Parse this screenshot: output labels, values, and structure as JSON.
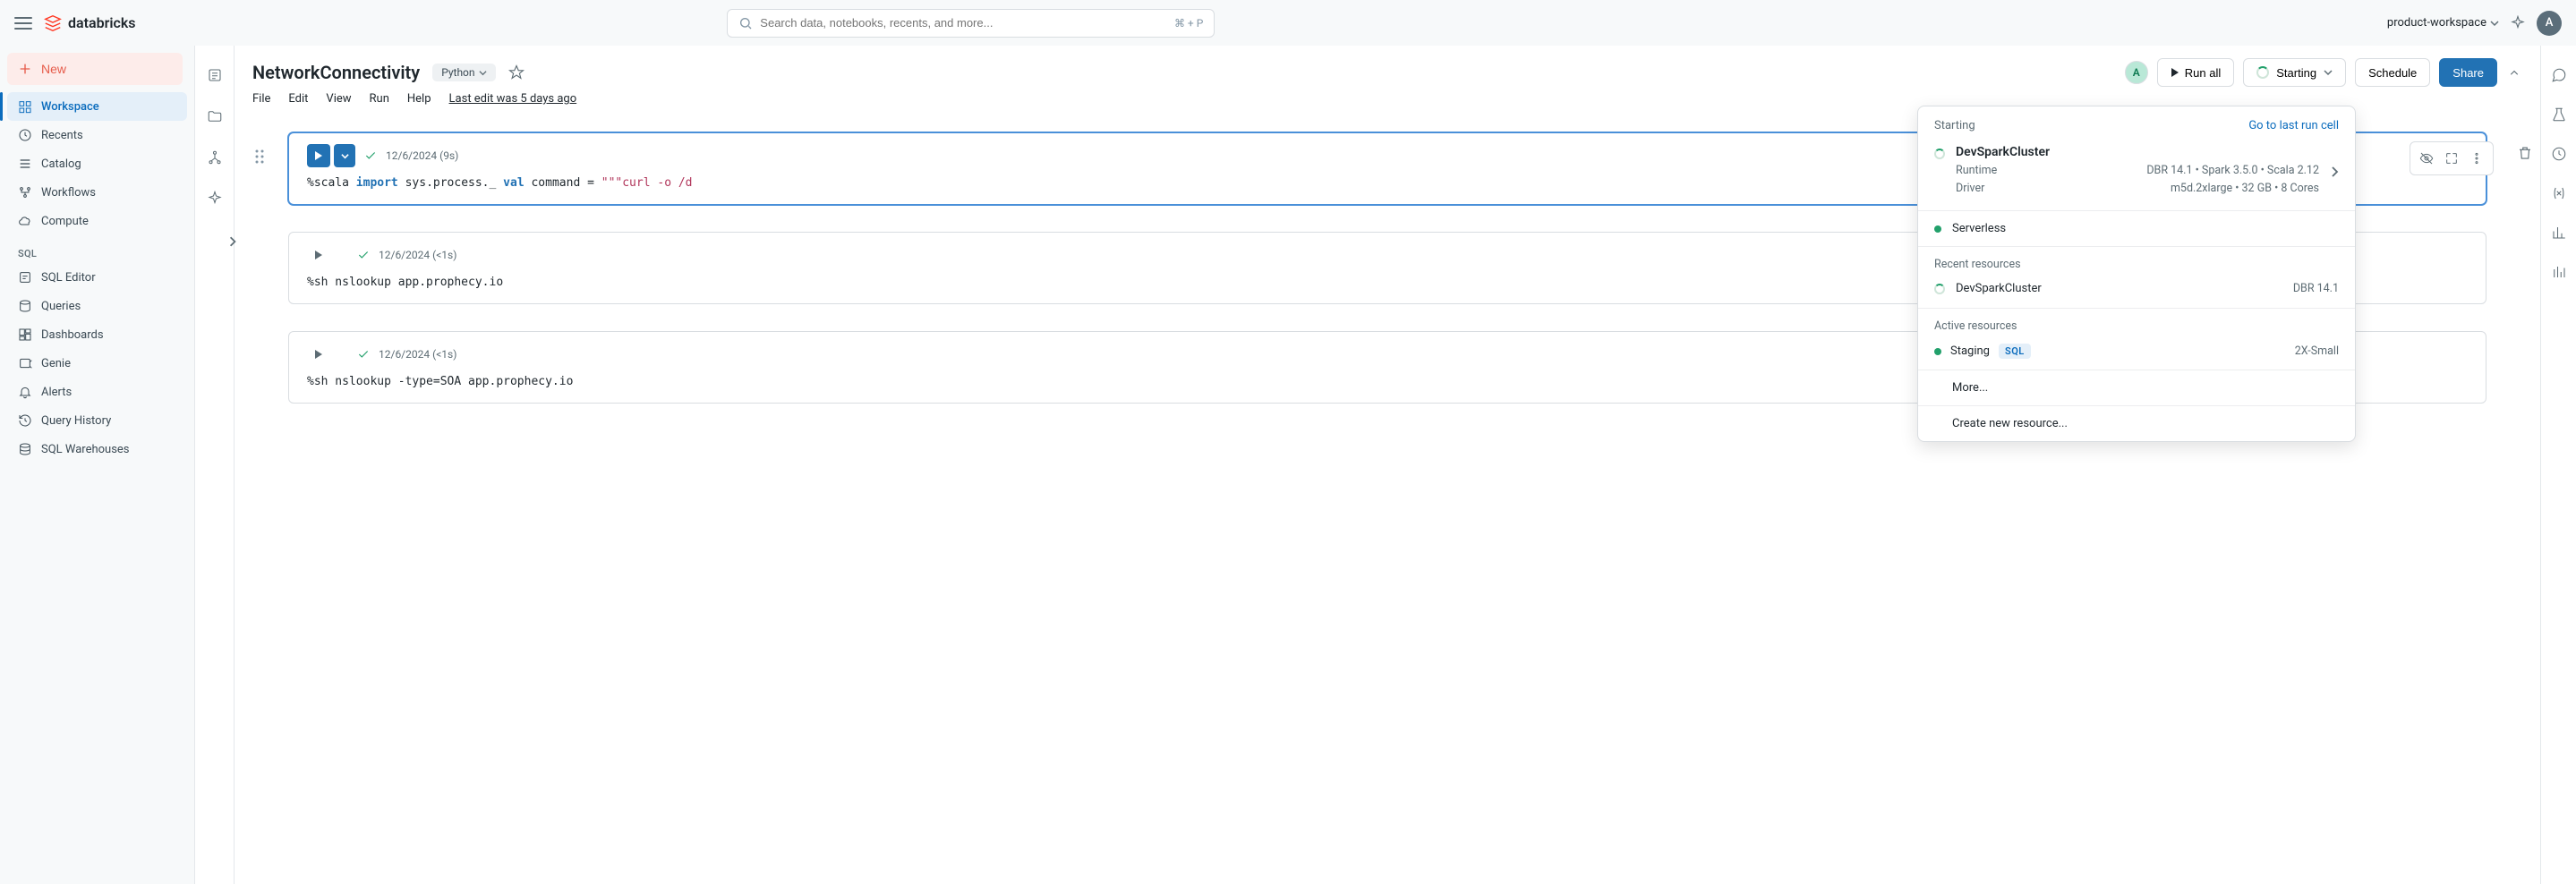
{
  "topbar": {
    "brand": "databricks",
    "search_placeholder": "Search data, notebooks, recents, and more...",
    "search_shortcut": "⌘ + P",
    "workspace": "product-workspace",
    "avatar_letter": "A"
  },
  "sidebar": {
    "new_label": "New",
    "items": [
      {
        "label": "Workspace"
      },
      {
        "label": "Recents"
      },
      {
        "label": "Catalog"
      },
      {
        "label": "Workflows"
      },
      {
        "label": "Compute"
      }
    ],
    "sql_label": "SQL",
    "sql_items": [
      {
        "label": "SQL Editor"
      },
      {
        "label": "Queries"
      },
      {
        "label": "Dashboards"
      },
      {
        "label": "Genie"
      },
      {
        "label": "Alerts"
      },
      {
        "label": "Query History"
      },
      {
        "label": "SQL Warehouses"
      }
    ]
  },
  "header": {
    "title": "NetworkConnectivity",
    "language": "Python",
    "avatar_letter": "A",
    "run_all": "Run all",
    "starting": "Starting",
    "schedule": "Schedule",
    "share": "Share"
  },
  "menubar": {
    "file": "File",
    "edit": "Edit",
    "view": "View",
    "run": "Run",
    "help": "Help",
    "last_edit": "Last edit was 5 days ago"
  },
  "cells": [
    {
      "timestamp": "12/6/2024 (9s)",
      "code_prefix": "%scala ",
      "code_kw1": "import",
      "code_mid": " sys.process._ ",
      "code_kw2": "val",
      "code_mid2": " command = ",
      "code_str": "\"\"\"curl -o /d"
    },
    {
      "timestamp": "12/6/2024 (<1s)",
      "code_plain": "%sh nslookup app.prophecy.io"
    },
    {
      "timestamp": "12/6/2024 (<1s)",
      "code_plain": "%sh nslookup -type=SOA app.prophecy.io"
    }
  ],
  "dropdown": {
    "status": "Starting",
    "go_to": "Go to last run cell",
    "cluster_name": "DevSparkCluster",
    "runtime_label": "Runtime",
    "runtime_value": "DBR 14.1 • Spark 3.5.0 • Scala 2.12",
    "driver_label": "Driver",
    "driver_value": "m5d.2xlarge • 32 GB • 8 Cores",
    "serverless": "Serverless",
    "recent_label": "Recent resources",
    "recent_name": "DevSparkCluster",
    "recent_meta": "DBR 14.1",
    "active_label": "Active resources",
    "active_name": "Staging",
    "active_tag": "SQL",
    "active_meta": "2X-Small",
    "more": "More...",
    "create": "Create new resource..."
  }
}
